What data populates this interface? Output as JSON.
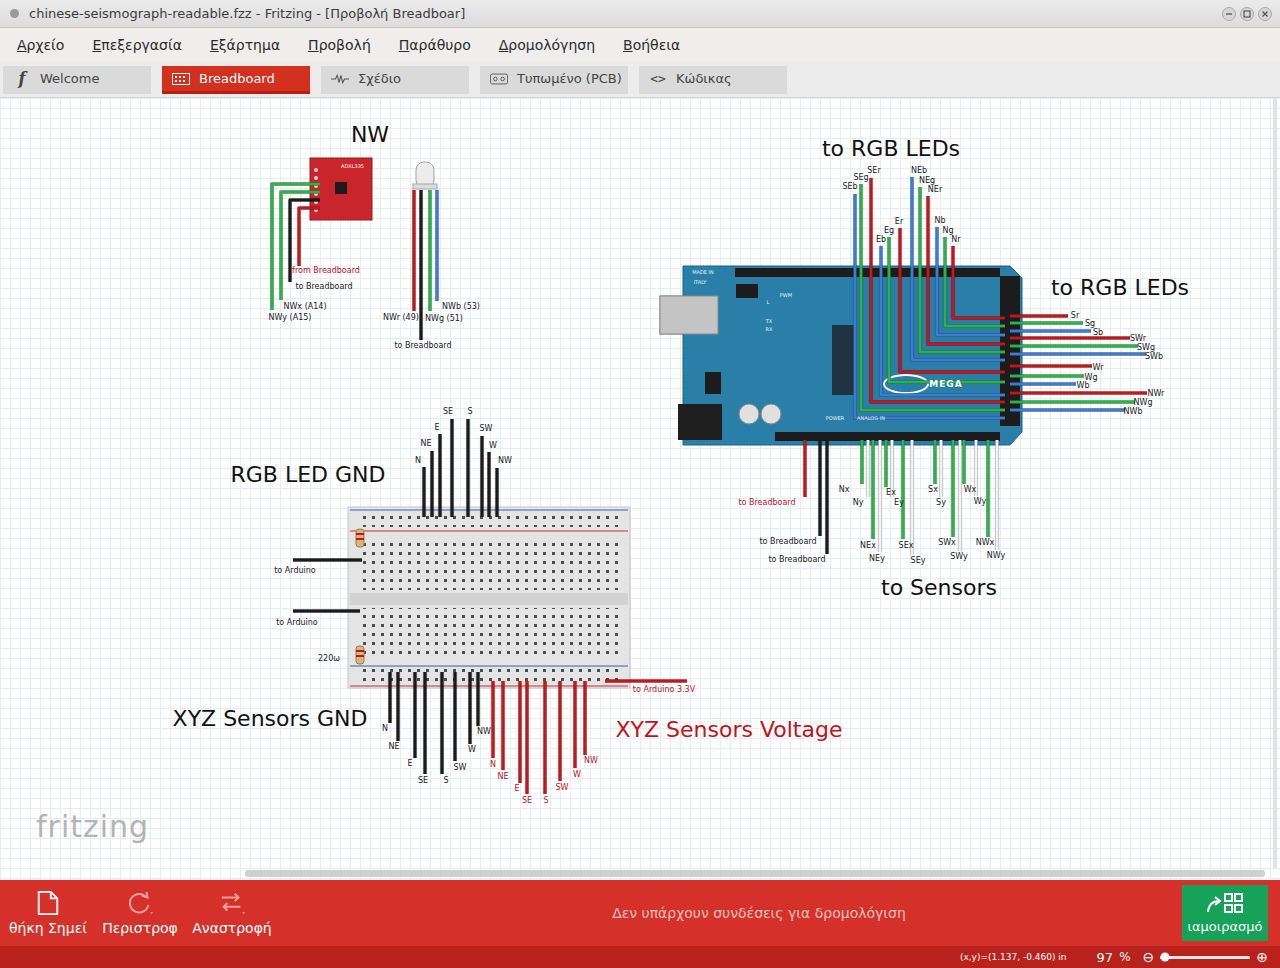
{
  "window": {
    "title": "chinese-seismograph-readable.fzz - Fritzing - [Προβολή Breadboar]"
  },
  "menu": [
    "Αρχείο",
    "Επεξεργασία",
    "Εξάρτημα",
    "Προβολή",
    "Παράθυρο",
    "Δρομολόγηση",
    "Βοήθεια"
  ],
  "tabs": [
    {
      "label": "Welcome",
      "kind": "welcome",
      "glyph": "f",
      "selected": false
    },
    {
      "label": "Breadboard",
      "kind": "breadboard",
      "selected": true
    },
    {
      "label": "Σχέδιο",
      "kind": "schematic",
      "selected": false
    },
    {
      "label": "Τυπωμένο (PCB)",
      "kind": "pcb",
      "selected": false
    },
    {
      "label": "Κώδικας",
      "kind": "code",
      "glyph": "<>",
      "selected": false
    }
  ],
  "canvas": {
    "headings": [
      {
        "text": "NW",
        "color": "#111111"
      },
      {
        "text": "to RGB LEDs",
        "color": "#111111"
      },
      {
        "text": "to RGB LEDs",
        "color": "#111111"
      },
      {
        "text": "RGB LED GND",
        "color": "#111111"
      },
      {
        "text": "XYZ Sensors GND",
        "color": "#111111"
      },
      {
        "text": "XYZ Sensors Voltage",
        "color": "#c0141a"
      },
      {
        "text": "to Sensors",
        "color": "#111111"
      }
    ],
    "labels": [
      {
        "text": "from Breadboard",
        "color": "#c0141a"
      },
      {
        "text": "to Breadboard",
        "color": "#222222"
      },
      {
        "text": "NWx (A14)",
        "color": "#222222"
      },
      {
        "text": "NWy (A15)",
        "color": "#222222"
      },
      {
        "text": "NWr (49)",
        "color": "#222222"
      },
      {
        "text": "NWg (51)",
        "color": "#222222"
      },
      {
        "text": "NWb (53)",
        "color": "#222222"
      },
      {
        "text": "to Breadboard",
        "color": "#222222"
      },
      {
        "text": "SEr",
        "color": "#222222"
      },
      {
        "text": "SEg",
        "color": "#222222"
      },
      {
        "text": "SEb",
        "color": "#222222"
      },
      {
        "text": "NEb",
        "color": "#222222"
      },
      {
        "text": "NEg",
        "color": "#222222"
      },
      {
        "text": "NEr",
        "color": "#222222"
      },
      {
        "text": "Er",
        "color": "#222222"
      },
      {
        "text": "Eg",
        "color": "#222222"
      },
      {
        "text": "Eb",
        "color": "#222222"
      },
      {
        "text": "Nb",
        "color": "#222222"
      },
      {
        "text": "Ng",
        "color": "#222222"
      },
      {
        "text": "Nr",
        "color": "#222222"
      },
      {
        "text": "Sr",
        "color": "#222222"
      },
      {
        "text": "Sg",
        "color": "#222222"
      },
      {
        "text": "Sb",
        "color": "#222222"
      },
      {
        "text": "SWr",
        "color": "#222222"
      },
      {
        "text": "SWg",
        "color": "#222222"
      },
      {
        "text": "SWb",
        "color": "#222222"
      },
      {
        "text": "Wr",
        "color": "#222222"
      },
      {
        "text": "Wg",
        "color": "#222222"
      },
      {
        "text": "Wb",
        "color": "#222222"
      },
      {
        "text": "NWr",
        "color": "#222222"
      },
      {
        "text": "NWg",
        "color": "#222222"
      },
      {
        "text": "NWb",
        "color": "#222222"
      },
      {
        "text": "to Breadboard",
        "color": "#c0141a"
      },
      {
        "text": "to Breadboard",
        "color": "#222222"
      },
      {
        "text": "to Breadboard",
        "color": "#222222"
      },
      {
        "text": "Nx",
        "color": "#222222"
      },
      {
        "text": "Ny",
        "color": "#222222"
      },
      {
        "text": "Ex",
        "color": "#222222"
      },
      {
        "text": "Ey",
        "color": "#222222"
      },
      {
        "text": "NEx",
        "color": "#222222"
      },
      {
        "text": "NEy",
        "color": "#222222"
      },
      {
        "text": "SEx",
        "color": "#222222"
      },
      {
        "text": "SEy",
        "color": "#222222"
      },
      {
        "text": "Sx",
        "color": "#222222"
      },
      {
        "text": "Sy",
        "color": "#222222"
      },
      {
        "text": "Wx",
        "color": "#222222"
      },
      {
        "text": "Wy",
        "color": "#222222"
      },
      {
        "text": "SWx",
        "color": "#222222"
      },
      {
        "text": "SWy",
        "color": "#222222"
      },
      {
        "text": "NWx",
        "color": "#222222"
      },
      {
        "text": "NWy",
        "color": "#222222"
      },
      {
        "text": "N",
        "color": "#222222"
      },
      {
        "text": "NE",
        "color": "#222222"
      },
      {
        "text": "E",
        "color": "#222222"
      },
      {
        "text": "SE",
        "color": "#222222"
      },
      {
        "text": "S",
        "color": "#222222"
      },
      {
        "text": "SW",
        "color": "#222222"
      },
      {
        "text": "W",
        "color": "#222222"
      },
      {
        "text": "NW",
        "color": "#222222"
      },
      {
        "text": "to Arduino",
        "color": "#222222"
      },
      {
        "text": "to Arduino",
        "color": "#222222"
      },
      {
        "text": "220ω",
        "color": "#222222"
      },
      {
        "text": "to Arduino 3.3V",
        "color": "#c0141a"
      },
      {
        "text": "N",
        "color": "#222222"
      },
      {
        "text": "NE",
        "color": "#222222"
      },
      {
        "text": "E",
        "color": "#222222"
      },
      {
        "text": "SE",
        "color": "#222222"
      },
      {
        "text": "S",
        "color": "#222222"
      },
      {
        "text": "SW",
        "color": "#222222"
      },
      {
        "text": "W",
        "color": "#222222"
      },
      {
        "text": "NW",
        "color": "#222222"
      },
      {
        "text": "N",
        "color": "#c0141a"
      },
      {
        "text": "NE",
        "color": "#c0141a"
      },
      {
        "text": "E",
        "color": "#c0141a"
      },
      {
        "text": "SE",
        "color": "#c0141a"
      },
      {
        "text": "S",
        "color": "#c0141a"
      },
      {
        "text": "SW",
        "color": "#c0141a"
      },
      {
        "text": "W",
        "color": "#c0141a"
      },
      {
        "text": "NW",
        "color": "#c0141a"
      }
    ],
    "board_marks": [
      "MADE IN",
      "ITALY",
      "L",
      "PWM",
      "TX",
      "RX",
      "MEGA",
      "POWER",
      "ANALOG IN"
    ],
    "chip_label": "ADXL335",
    "watermark": "fritzing"
  },
  "toolbar": {
    "buttons": [
      {
        "label": "θήκη Σημεί",
        "kind": "note"
      },
      {
        "label": "Περιστροφ",
        "kind": "rotate"
      },
      {
        "label": "Αναστροφή",
        "kind": "flip"
      }
    ],
    "message": "Δεν υπάρχουν συνδέσεις για δρομολόγιση",
    "share": "ιαμοιρασμό"
  },
  "status_bar": {
    "coords": "(x,y)=(1.137, -0.460) in",
    "zoom": "97",
    "unit": "%",
    "zoom_out": "⊖",
    "zoom_in": "⊕",
    "zoom_level": 0.05
  }
}
